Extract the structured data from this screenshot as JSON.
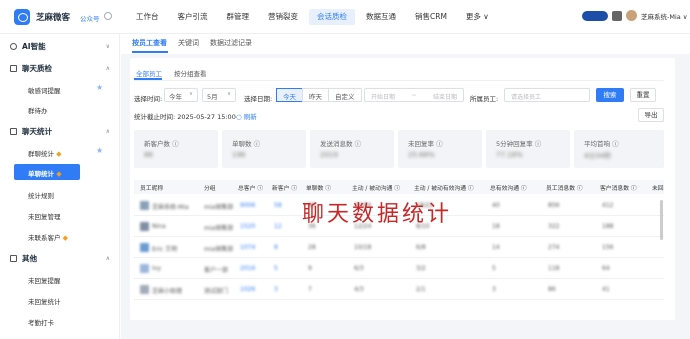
{
  "brand": {
    "name": "芝麻微客",
    "sub_label": "公众号"
  },
  "nav": [
    "工作台",
    "客户引流",
    "群管理",
    "营销裂变",
    "会话质检",
    "数据互通",
    "销售CRM",
    "更多 ∨"
  ],
  "user": {
    "name": "芝麻系统-Mia ∨"
  },
  "sidebar": {
    "groups": [
      {
        "label": "AI智能",
        "chevron": "∨"
      },
      {
        "label": "聊天质检",
        "chevron": "∧"
      },
      {
        "label": "聊天统计",
        "chevron": "∧"
      },
      {
        "label": "其他",
        "chevron": "∧"
      }
    ],
    "items": [
      "敏感词提醒",
      "群待办",
      "群聊统计",
      "单聊统计",
      "统计规则",
      "未回复管理",
      "未联系客户",
      "未回复提醒",
      "未回复统计",
      "考勤打卡"
    ],
    "star": "★",
    "badge": "◆"
  },
  "subtabs": [
    "按员工查看",
    "关键词",
    "数据过滤记录"
  ],
  "inner_tabs": [
    "全部员工",
    "按分组查看"
  ],
  "filters": {
    "time_label": "选择时间:",
    "year": "今年",
    "month": "5月",
    "date_label": "选择日期:",
    "today": "今天",
    "yesterday": "昨天",
    "custom": "自定义",
    "start_placeholder": "开始日期",
    "arrow": "~",
    "end_placeholder": "结束日期",
    "employee_label": "所属员工:",
    "employee_placeholder": "请选择员工",
    "search": "搜索",
    "reset": "重置",
    "export": "导出"
  },
  "stat_time": "统计截止时间: 2025-05-27 15:00",
  "refresh": "○ 刷新",
  "metrics": [
    {
      "title": "新客户数 ⓘ",
      "value": "86"
    },
    {
      "title": "单聊数 ⓘ",
      "value": "196"
    },
    {
      "title": "发送消息数 ⓘ",
      "value": "2019"
    },
    {
      "title": "未回复率 ⓘ",
      "value": "25.68%"
    },
    {
      "title": "5分钟回复率 ⓘ",
      "value": "77.18%"
    },
    {
      "title": "平均首响 ⓘ",
      "value": "4分34秒"
    }
  ],
  "table": {
    "headers": [
      "员工昵称",
      "分组",
      "总客户 ⓘ",
      "新客户 ⓘ",
      "单聊数 ⓘ",
      "主动 / 被动沟通 ⓘ",
      "主动 / 被动有效沟通 ⓘ",
      "总有效沟通 ⓘ",
      "员工消息数 ⓘ",
      "客户消息数 ⓘ",
      "未回"
    ],
    "rows": [
      [
        "芝麻系统-Mia",
        "mia销售部",
        "9006",
        "58",
        "96",
        "32/64",
        "18/22",
        "40",
        "856",
        "412"
      ],
      [
        "Nina",
        "mia销售部",
        "1520",
        "12",
        "36",
        "12/24",
        "8/10",
        "18",
        "322",
        "188"
      ],
      [
        "Eric 王明",
        "mia销售部",
        "1074",
        "8",
        "28",
        "10/18",
        "6/8",
        "14",
        "274",
        "156"
      ],
      [
        "Ivy",
        "客户一部",
        "2016",
        "5",
        "9",
        "6/3",
        "3/2",
        "5",
        "118",
        "64"
      ],
      [
        "芝麻小助理",
        "测试部门",
        "1026",
        "3",
        "7",
        "4/3",
        "2/1",
        "3",
        "86",
        "41"
      ]
    ]
  },
  "watermark": "聊天数据统计",
  "colors": {
    "primary": "#2f7cf6",
    "watermark": "#c62828"
  }
}
